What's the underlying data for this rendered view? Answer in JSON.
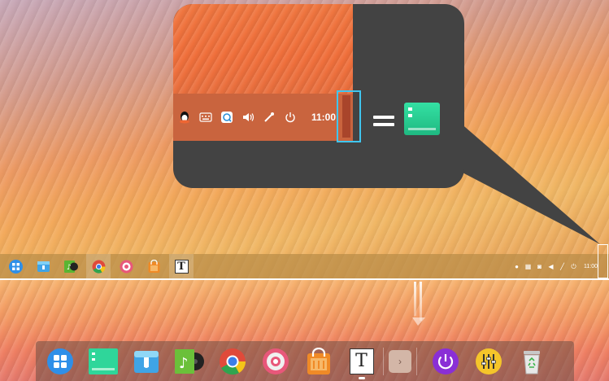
{
  "top_taskbar": {
    "apps": [
      {
        "name": "launcher-icon",
        "color": "#2f8fe8"
      },
      {
        "name": "file-manager-icon",
        "color": "#3fa4e6"
      },
      {
        "name": "music-icon",
        "color": "#5ab532"
      },
      {
        "name": "chrome-icon",
        "color": "#e04a3a",
        "active": true
      },
      {
        "name": "settings-icon",
        "color": "#e8577a"
      },
      {
        "name": "store-icon",
        "color": "#f08a26"
      },
      {
        "name": "text-editor-icon",
        "color": "#ffffff",
        "active": true
      }
    ],
    "clock": "11:00"
  },
  "callout": {
    "clock": "11:00",
    "tray_icons": [
      "qq-icon",
      "keyboard-icon",
      "update-icon",
      "volume-icon",
      "network-icon",
      "power-icon"
    ]
  },
  "dock": {
    "apps": [
      {
        "name": "launcher-icon",
        "color": "#2f8fe8"
      },
      {
        "name": "show-desktop-icon",
        "color": "#2fd69a"
      },
      {
        "name": "file-manager-icon",
        "color": "#3fa4e6"
      },
      {
        "name": "music-icon",
        "color": "#5ab532"
      },
      {
        "name": "chrome-icon",
        "color": "#e04a3a"
      },
      {
        "name": "settings-icon",
        "color": "#e8577a"
      },
      {
        "name": "store-icon",
        "color": "#f08a26"
      },
      {
        "name": "text-editor-icon",
        "color": "#ffffff"
      }
    ],
    "expand_label": "›",
    "plugins": [
      {
        "name": "shutdown-icon",
        "color": "#8a2fd6"
      },
      {
        "name": "mixer-icon",
        "color": "#f5c52a"
      },
      {
        "name": "trash-icon",
        "color": "#e8e8e8"
      }
    ]
  },
  "text_editor_glyph": "T"
}
